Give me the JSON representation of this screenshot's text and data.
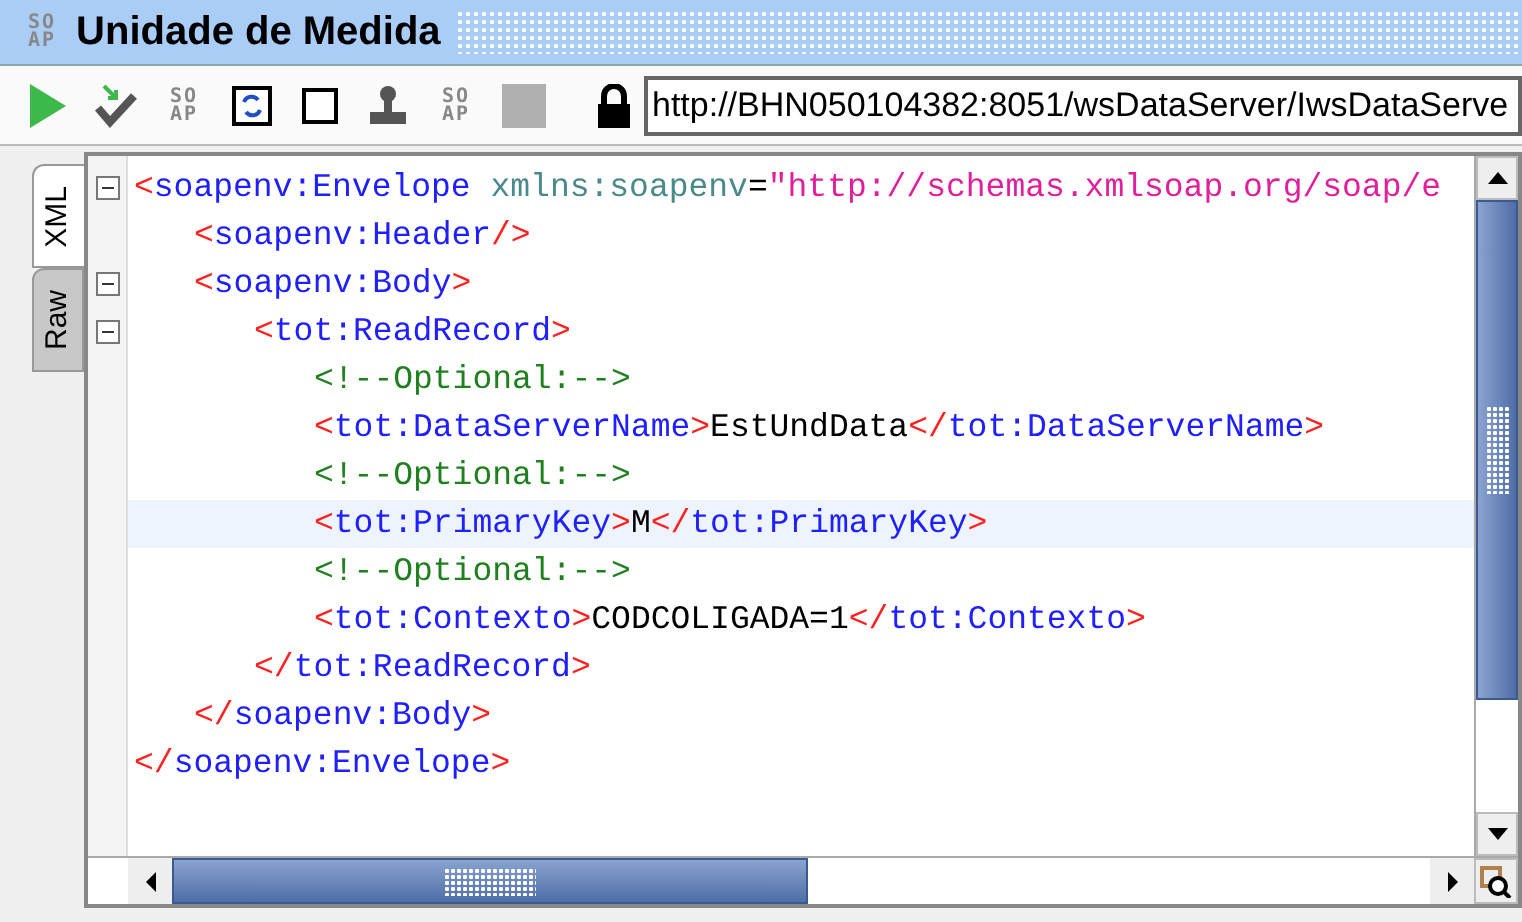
{
  "window": {
    "title": "Unidade de Medida",
    "icon_text": [
      "SO",
      "AP"
    ]
  },
  "toolbar": {
    "buttons": [
      {
        "kind": "run",
        "disabled": false
      },
      {
        "kind": "check",
        "disabled": false
      },
      {
        "kind": "soap",
        "text": [
          "SO",
          "AP"
        ],
        "disabled": false
      },
      {
        "kind": "refresh",
        "disabled": false
      },
      {
        "kind": "square",
        "disabled": false
      },
      {
        "kind": "stamp",
        "disabled": false
      },
      {
        "kind": "soap",
        "text": [
          "SO",
          "AP"
        ],
        "disabled": false
      },
      {
        "kind": "blank",
        "disabled": true
      }
    ],
    "url": "http://BHN050104382:8051/wsDataServer/IwsDataServe"
  },
  "tabs": [
    {
      "label": "XML",
      "selected": true
    },
    {
      "label": "Raw",
      "selected": false
    }
  ],
  "editor": {
    "nodes": [
      {
        "tokens": [
          {
            "kind": "bracket",
            "text": "<"
          },
          {
            "kind": "name",
            "text": "soapenv:Envelope "
          },
          {
            "kind": "attr",
            "text": "xmlns:soapenv"
          },
          {
            "kind": "text",
            "text": "="
          },
          {
            "kind": "value",
            "text": "\"http://schemas.xmlsoap.org/soap/e"
          }
        ],
        "expanded": true,
        "highlighted": false,
        "close": [
          {
            "kind": "bracket",
            "text": "</"
          },
          {
            "kind": "name",
            "text": "soapenv:Envelope"
          },
          {
            "kind": "bracket",
            "text": ">"
          }
        ],
        "children": [
          {
            "tokens": [
              {
                "kind": "bracket",
                "text": "<"
              },
              {
                "kind": "name",
                "text": "soapenv:Header"
              },
              {
                "kind": "bracket",
                "text": "/>"
              }
            ],
            "highlighted": false
          },
          {
            "tokens": [
              {
                "kind": "bracket",
                "text": "<"
              },
              {
                "kind": "name",
                "text": "soapenv:Body"
              },
              {
                "kind": "bracket",
                "text": ">"
              }
            ],
            "expanded": true,
            "highlighted": false,
            "close": [
              {
                "kind": "bracket",
                "text": "</"
              },
              {
                "kind": "name",
                "text": "soapenv:Body"
              },
              {
                "kind": "bracket",
                "text": ">"
              }
            ],
            "children": [
              {
                "tokens": [
                  {
                    "kind": "bracket",
                    "text": "<"
                  },
                  {
                    "kind": "name",
                    "text": "tot:ReadRecord"
                  },
                  {
                    "kind": "bracket",
                    "text": ">"
                  }
                ],
                "expanded": true,
                "highlighted": false,
                "close": [
                  {
                    "kind": "bracket",
                    "text": "</"
                  },
                  {
                    "kind": "name",
                    "text": "tot:ReadRecord"
                  },
                  {
                    "kind": "bracket",
                    "text": ">"
                  }
                ],
                "children": [
                  {
                    "tokens": [
                      {
                        "kind": "comment",
                        "text": "<!--Optional:-->"
                      }
                    ],
                    "highlighted": false
                  },
                  {
                    "tokens": [
                      {
                        "kind": "bracket",
                        "text": "<"
                      },
                      {
                        "kind": "name",
                        "text": "tot:DataServerName"
                      },
                      {
                        "kind": "bracket",
                        "text": ">"
                      },
                      {
                        "kind": "text",
                        "text": "EstUndData"
                      },
                      {
                        "kind": "bracket",
                        "text": "</"
                      },
                      {
                        "kind": "name",
                        "text": "tot:DataServerName"
                      },
                      {
                        "kind": "bracket",
                        "text": ">"
                      }
                    ],
                    "highlighted": false
                  },
                  {
                    "tokens": [
                      {
                        "kind": "comment",
                        "text": "<!--Optional:-->"
                      }
                    ],
                    "highlighted": false
                  },
                  {
                    "tokens": [
                      {
                        "kind": "bracket",
                        "text": "<"
                      },
                      {
                        "kind": "name",
                        "text": "tot:PrimaryKey"
                      },
                      {
                        "kind": "bracket",
                        "text": ">"
                      },
                      {
                        "kind": "text",
                        "text": "M"
                      },
                      {
                        "kind": "bracket",
                        "text": "</"
                      },
                      {
                        "kind": "name",
                        "text": "tot:PrimaryKey"
                      },
                      {
                        "kind": "bracket",
                        "text": ">"
                      }
                    ],
                    "highlighted": true
                  },
                  {
                    "tokens": [
                      {
                        "kind": "comment",
                        "text": "<!--Optional:-->"
                      }
                    ],
                    "highlighted": false
                  },
                  {
                    "tokens": [
                      {
                        "kind": "bracket",
                        "text": "<"
                      },
                      {
                        "kind": "name",
                        "text": "tot:Contexto"
                      },
                      {
                        "kind": "bracket",
                        "text": ">"
                      },
                      {
                        "kind": "text",
                        "text": "CODCOLIGADA=1"
                      },
                      {
                        "kind": "bracket",
                        "text": "</"
                      },
                      {
                        "kind": "name",
                        "text": "tot:Contexto"
                      },
                      {
                        "kind": "bracket",
                        "text": ">"
                      }
                    ],
                    "highlighted": false
                  }
                ]
              }
            ]
          }
        ]
      }
    ]
  }
}
